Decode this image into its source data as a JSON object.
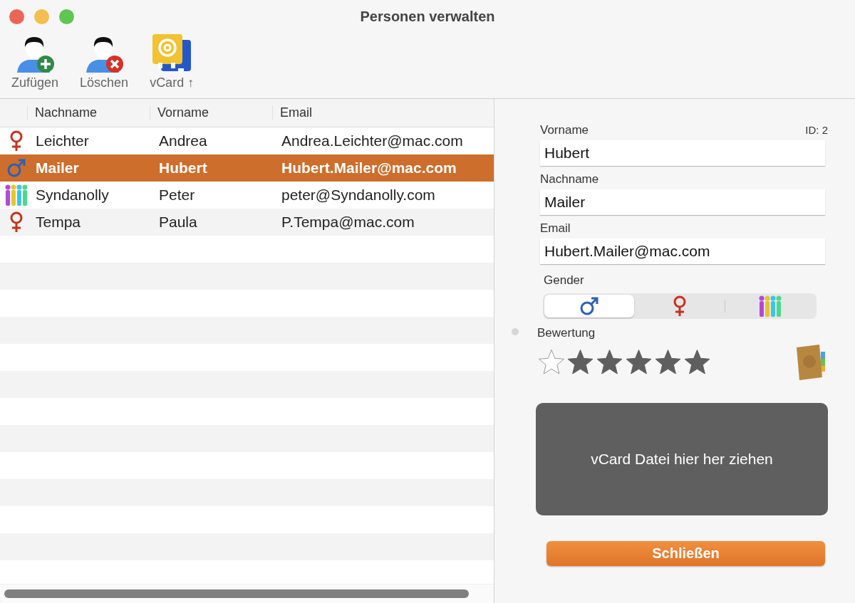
{
  "window": {
    "title": "Personen verwalten"
  },
  "toolbar": [
    {
      "label": "Zufügen",
      "kind": "add"
    },
    {
      "label": "Löschen",
      "kind": "delete"
    },
    {
      "label": "vCard ↑",
      "kind": "vcard"
    }
  ],
  "table": {
    "columns": [
      "Nachname",
      "Vorname",
      "Email"
    ],
    "rows": [
      {
        "kind": "female",
        "last": "Leichter",
        "first": "Andrea",
        "email": "Andrea.Leichter@mac.com",
        "selected": false
      },
      {
        "kind": "male",
        "last": "Mailer",
        "first": "Hubert",
        "email": "Hubert.Mailer@mac.com",
        "selected": true
      },
      {
        "kind": "diverse",
        "last": "Syndanolly",
        "first": "Peter",
        "email": "peter@Syndanolly.com",
        "selected": false
      },
      {
        "kind": "female",
        "last": "Tempa",
        "first": "Paula",
        "email": "P.Tempa@mac.com",
        "selected": false
      }
    ]
  },
  "detail": {
    "id_label": "ID: 2",
    "fields": [
      {
        "label": "Vorname",
        "value": "Hubert"
      },
      {
        "label": "Nachname",
        "value": "Mailer"
      },
      {
        "label": "Email",
        "value": "Hubert.Mailer@mac.com"
      }
    ],
    "gender": {
      "label": "Gender",
      "options": [
        {
          "kind": "male",
          "selected": true
        },
        {
          "kind": "female",
          "selected": false
        },
        {
          "kind": "diverse",
          "selected": false
        }
      ]
    },
    "rating": {
      "label": "Bewertung",
      "stars": 5
    },
    "drop_zone": "vCard Datei hier her ziehen",
    "close_button": "Schließen"
  }
}
